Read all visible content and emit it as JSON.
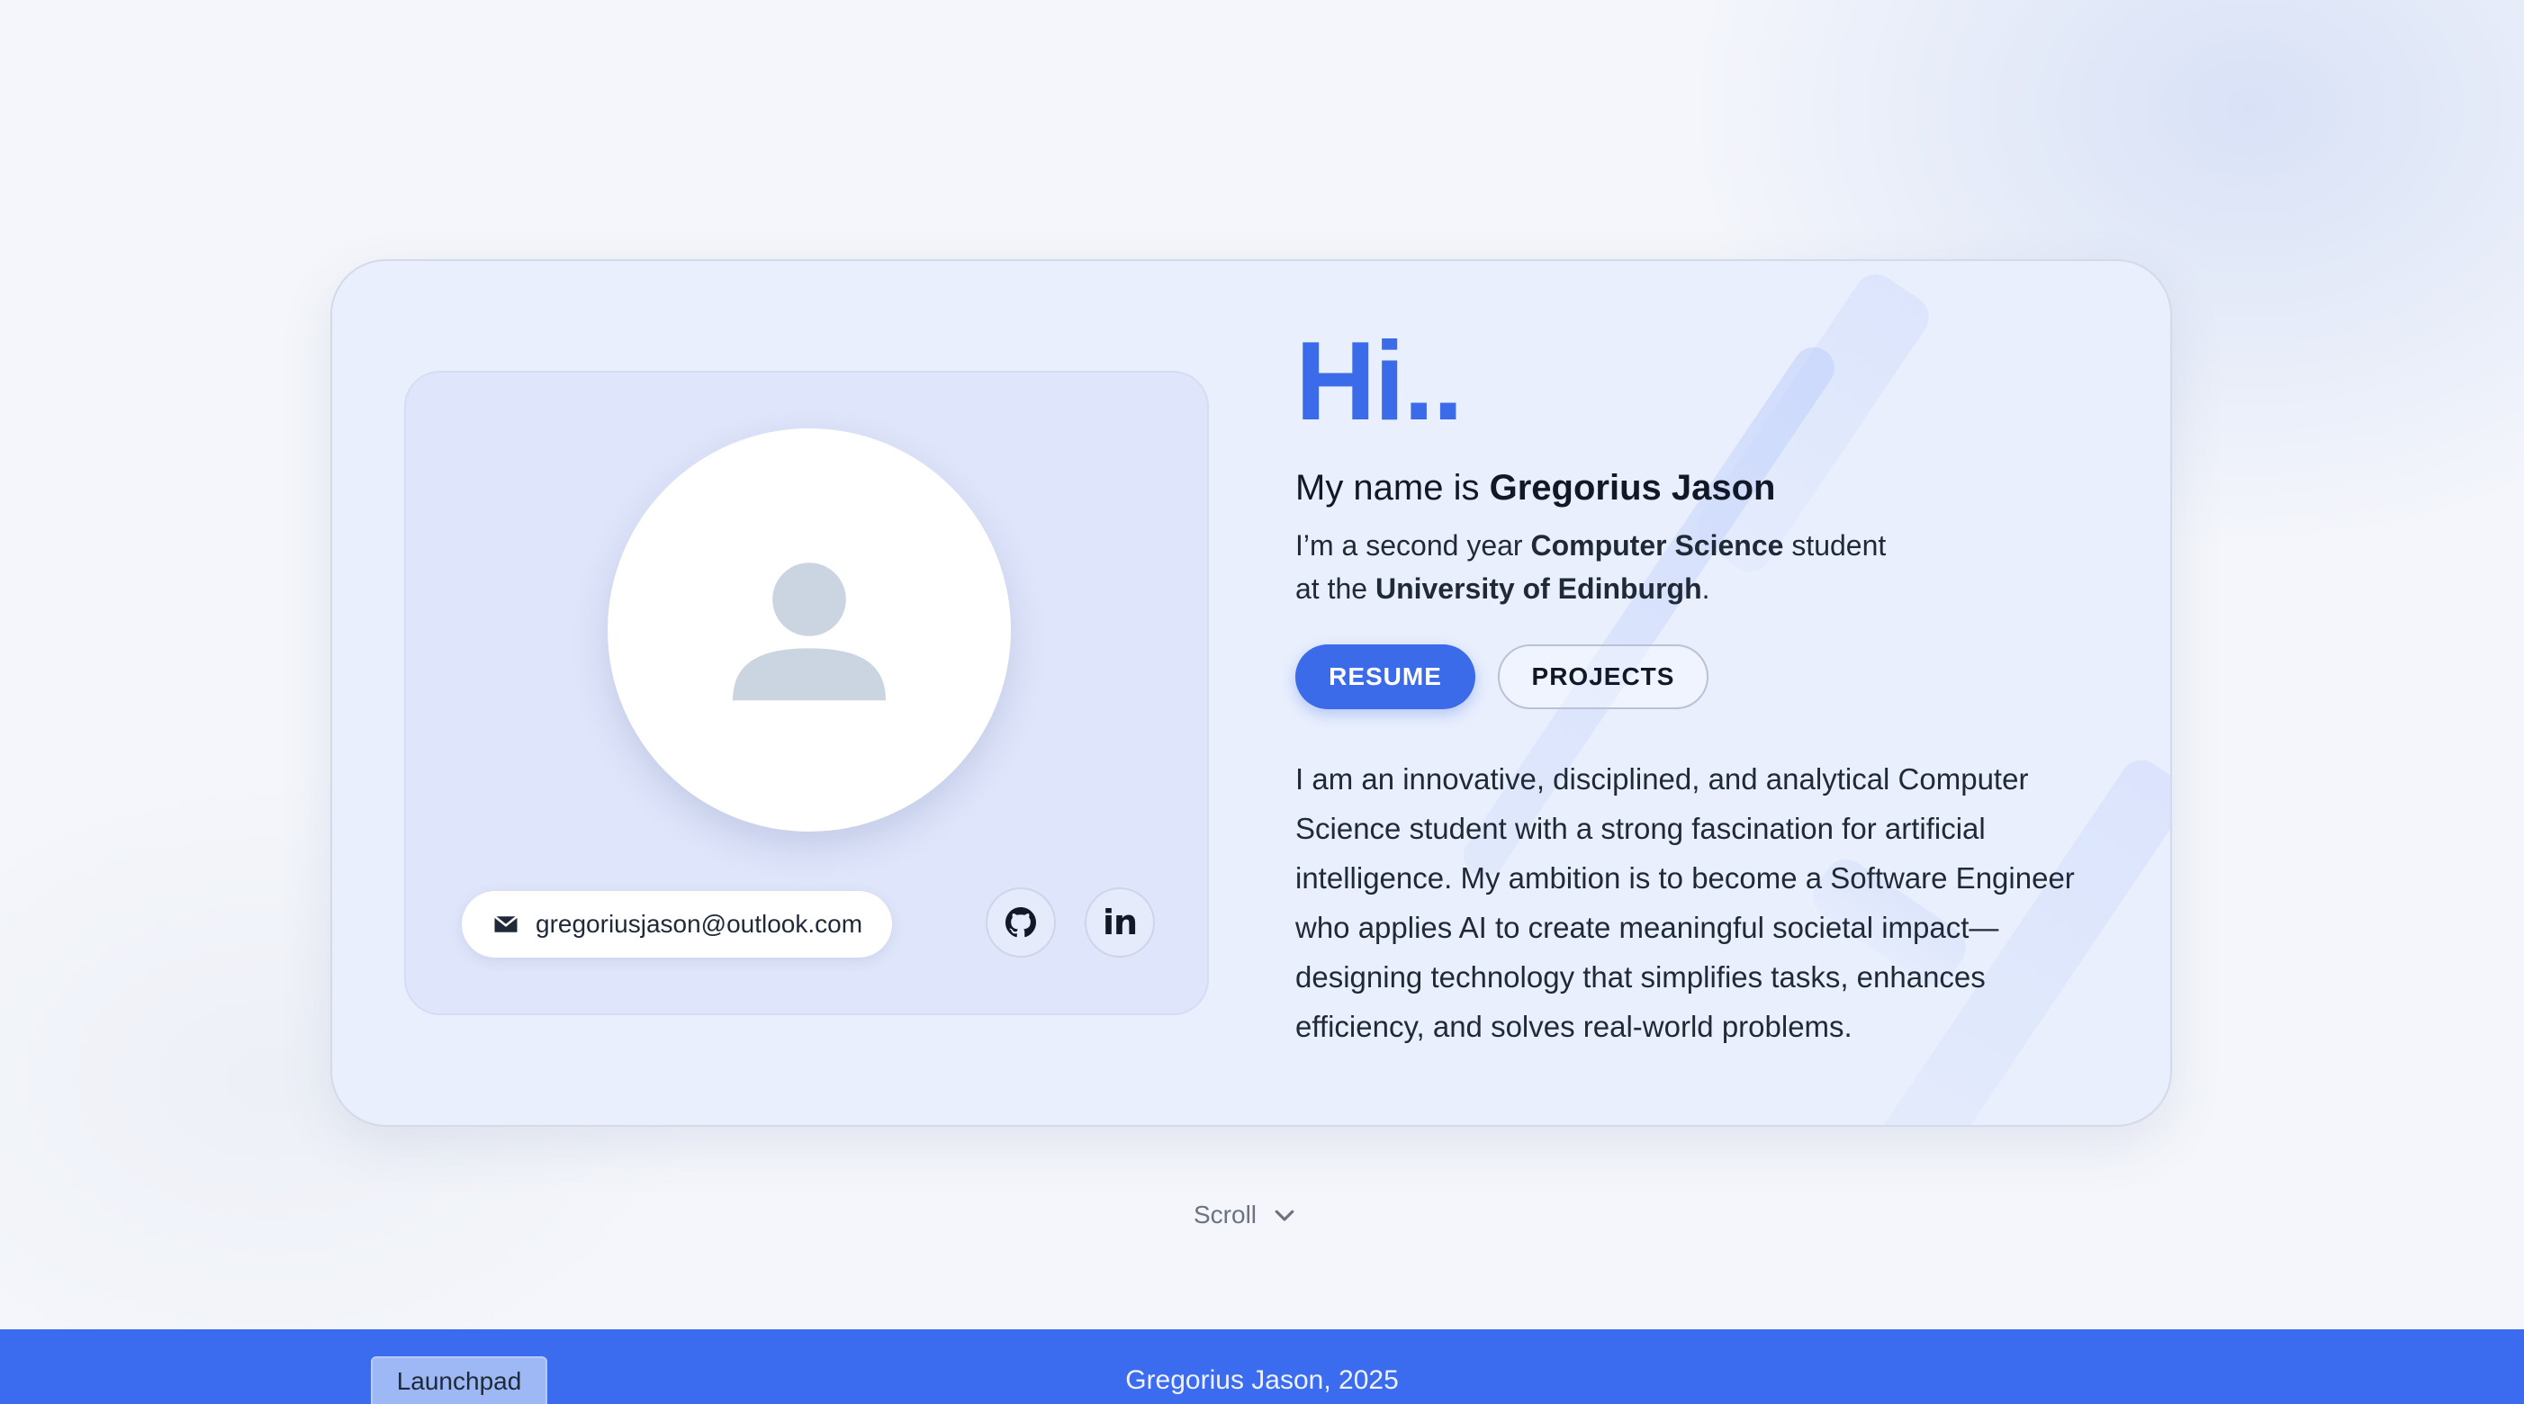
{
  "profile": {
    "email": "gregoriusjason@outlook.com",
    "avatar_icon": "user-silhouette-icon",
    "social_links": [
      {
        "name": "GitHub",
        "icon": "github-icon"
      },
      {
        "name": "LinkedIn",
        "icon": "linkedin-icon",
        "glyph": "in"
      }
    ]
  },
  "intro": {
    "greeting": "Hi..",
    "name_prefix": "My name is ",
    "name": "Gregorius Jason",
    "subtitle_part1": "I’m a second year ",
    "subtitle_bold1": "Computer Science",
    "subtitle_part2": " student",
    "subtitle_part3": "at the ",
    "subtitle_bold2": "University of Edinburgh",
    "subtitle_part4": "."
  },
  "buttons": {
    "resume": "RESUME",
    "projects": "PROJECTS"
  },
  "bio": "I am an innovative, disciplined, and analytical Computer Science student with a strong fascination for artificial intelligence. My ambition is to become a Software Engineer who applies AI to create meaningful societal impact—designing technology that simplifies tasks, enhances efficiency, and solves real-world problems.",
  "scroll": {
    "label": "Scroll",
    "icon": "chevron-down-icon"
  },
  "footer": {
    "launchpad": "Launchpad",
    "copyright": "Gregorius Jason, 2025"
  },
  "colors": {
    "accent": "#3b6be8",
    "footer": "#3b6cf0",
    "card_bg": "#e9effd",
    "panel_bg": "#dfe5fa"
  }
}
